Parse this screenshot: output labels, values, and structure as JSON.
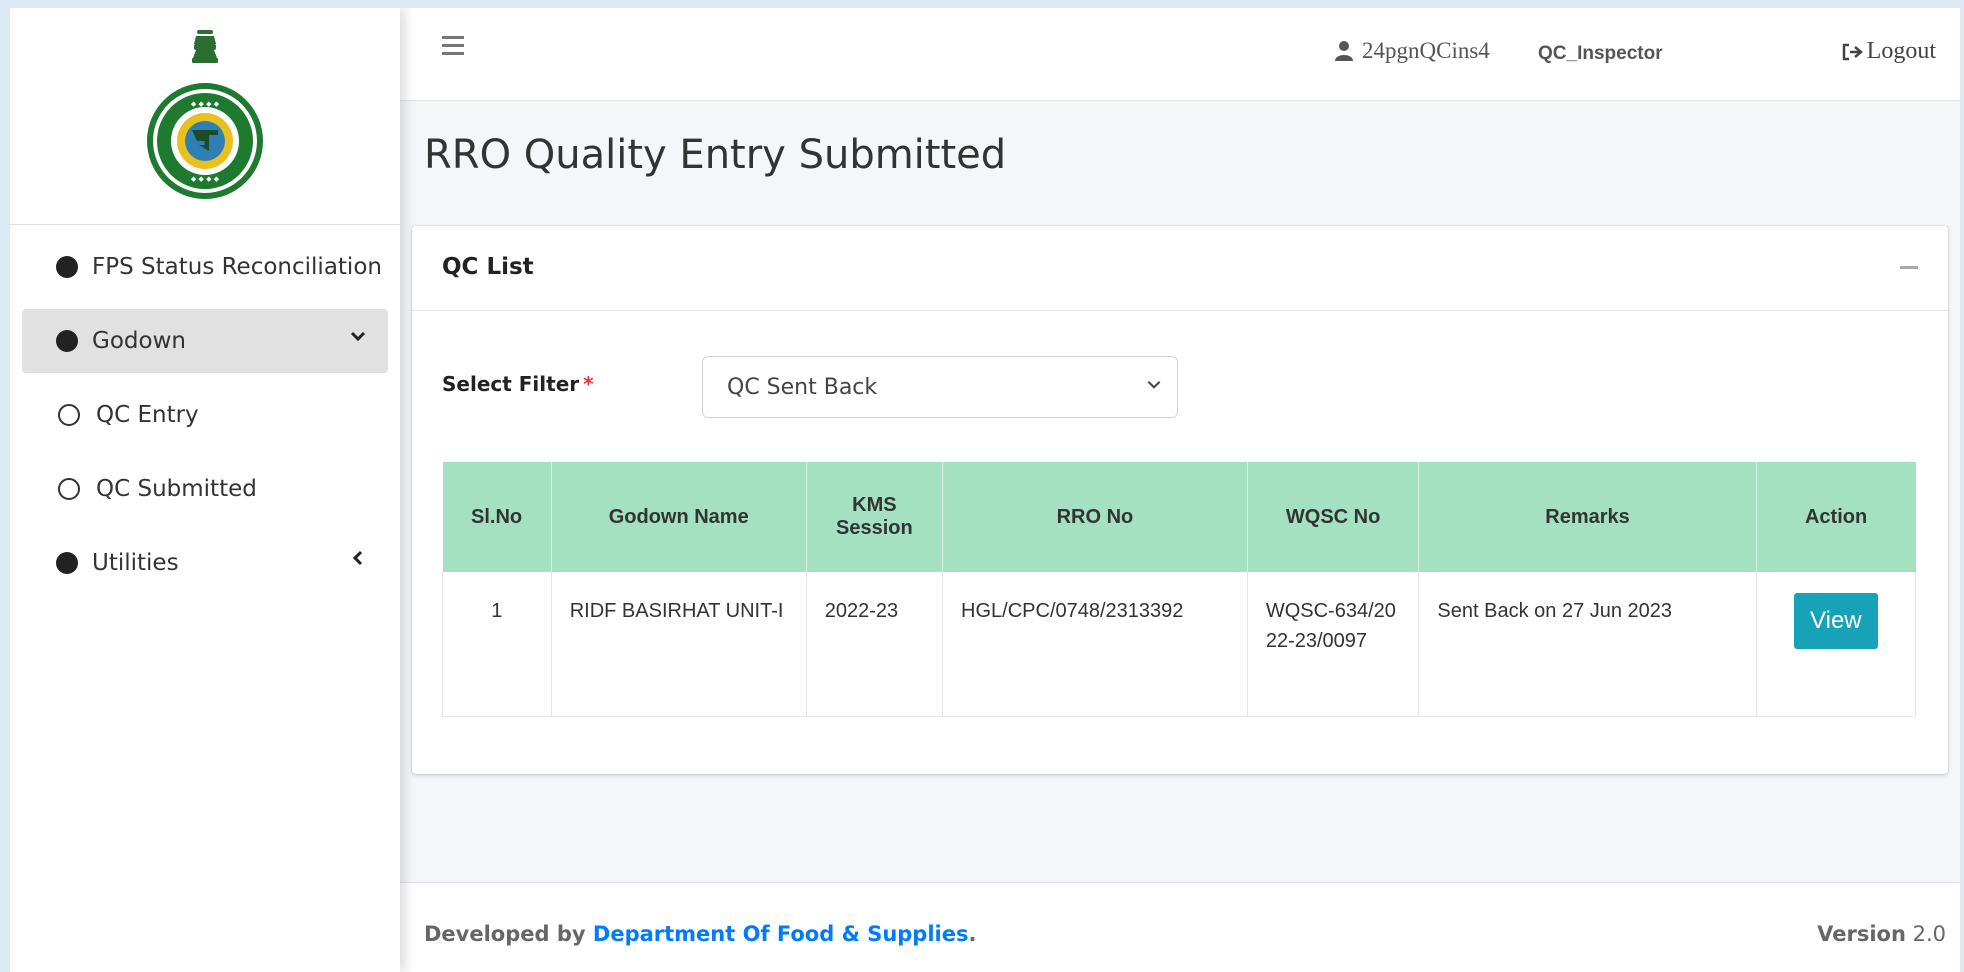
{
  "header": {
    "username": "24pgnQCins4",
    "role": "QC_Inspector",
    "logout_label": "Logout"
  },
  "sidebar": {
    "items": [
      {
        "label": "FPS Status Reconciliation"
      },
      {
        "label": "Godown"
      },
      {
        "label": "QC Entry"
      },
      {
        "label": "QC Submitted"
      },
      {
        "label": "Utilities"
      }
    ]
  },
  "page": {
    "title": "RRO Quality Entry Submitted"
  },
  "card": {
    "title": "QC List",
    "filter_label": "Select Filter",
    "required_mark": "*",
    "filter_value": "QC Sent Back"
  },
  "table": {
    "headers": [
      "Sl.No",
      "Godown Name",
      "KMS Session",
      "RRO No",
      "WQSC No",
      "Remarks",
      "Action"
    ],
    "rows": [
      {
        "slno": "1",
        "godown": "RIDF BASIRHAT UNIT-I",
        "kms": "2022-23",
        "rro": "HGL/CPC/0748/2313392",
        "wqsc": "WQSC-634/2022-23/0097",
        "remarks": "Sent Back on 27 Jun 2023",
        "action": "View"
      }
    ]
  },
  "footer": {
    "developed_by": "Developed by",
    "department": "Department Of Food & Supplies",
    "period": ".",
    "version_label": "Version",
    "version_value": "2.0"
  },
  "colors": {
    "table_header": "#a3e1c1",
    "view_button": "#17a2b8",
    "link": "#007bff",
    "required": "#dc3545"
  }
}
